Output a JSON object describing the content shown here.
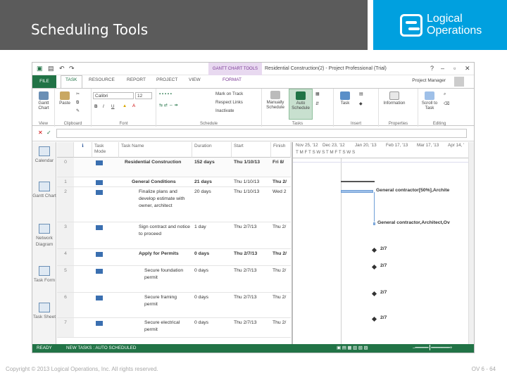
{
  "slide": {
    "title": "Scheduling Tools",
    "logo_line1": "Logical",
    "logo_line2": "Operations",
    "copyright": "Copyright © 2013 Logical Operations, Inc. All rights reserved.",
    "slide_num": "OV 6 - 64"
  },
  "app": {
    "context_tab": "GANTT CHART TOOLS",
    "window_title": "Residential Construction(2) - Project Professional (Trial)",
    "tabs": [
      "FILE",
      "TASK",
      "RESOURCE",
      "REPORT",
      "PROJECT",
      "VIEW",
      "FORMAT"
    ],
    "project_manager": "Project Manager",
    "ribbon": {
      "view": {
        "btn": "Gantt Chart",
        "label": "View"
      },
      "clipboard": {
        "paste": "Paste",
        "label": "Clipboard"
      },
      "font": {
        "name": "Calibri",
        "size": "12",
        "label": "Font"
      },
      "schedule": {
        "mark": "Mark on Track",
        "respect": "Respect Links",
        "inactivate": "Inactivate",
        "label": "Schedule"
      },
      "tasks": {
        "manual": "Manually Schedule",
        "auto": "Auto Schedule",
        "label": "Tasks"
      },
      "insert": {
        "task": "Task",
        "label": "Insert"
      },
      "properties": {
        "info": "Information",
        "label": "Properties"
      },
      "editing": {
        "scroll": "Scroll to Task",
        "label": "Editing"
      }
    },
    "views": [
      "Calendar",
      "Gantt Chart",
      "Network Diagram",
      "Task Form",
      "Task Sheet"
    ],
    "columns": [
      "Task Mode",
      "Task Name",
      "Duration",
      "Start",
      "Finish"
    ],
    "rows": [
      {
        "id": "0",
        "name": "Residential Construction",
        "duration": "152 days",
        "start": "Thu 1/10/13",
        "finish": "Fri 8/",
        "bold": true
      },
      {
        "id": "1",
        "name": "General Conditions",
        "duration": "21 days",
        "start": "Thu 1/10/13",
        "finish": "Thu 2/",
        "bold": true
      },
      {
        "id": "2",
        "name": "Finalize plans and develop estimate with owner, architect",
        "duration": "20 days",
        "start": "Thu 1/10/13",
        "finish": "Wed 2",
        "bold": false
      },
      {
        "id": "3",
        "name": "Sign contract and notice to proceed",
        "duration": "1 day",
        "start": "Thu 2/7/13",
        "finish": "Thu 2/",
        "bold": false
      },
      {
        "id": "4",
        "name": "Apply for Permits",
        "duration": "0 days",
        "start": "Thu 2/7/13",
        "finish": "Thu 2/",
        "bold": true
      },
      {
        "id": "5",
        "name": "Secure foundation permit",
        "duration": "0 days",
        "start": "Thu 2/7/13",
        "finish": "Thu 2/",
        "bold": false
      },
      {
        "id": "6",
        "name": "Secure framing permit",
        "duration": "0 days",
        "start": "Thu 2/7/13",
        "finish": "Thu 2/",
        "bold": false
      },
      {
        "id": "7",
        "name": "Secure electrical permit",
        "duration": "0 days",
        "start": "Thu 2/7/13",
        "finish": "Thu 2/",
        "bold": false
      }
    ],
    "gantt": {
      "months": [
        "Nov 25, '12",
        "Dec 23, '12",
        "Jan 20, '13",
        "Feb 17, '13",
        "Mar 17, '13",
        "Apr 14, '"
      ],
      "days": "T  M  F  T  S  W  S  T  M  F  T  S  W  S",
      "labels": [
        "General contractor[50%],Archite",
        "General contractor,Architect,Ov",
        "2/7",
        "2/7",
        "2/7",
        "2/7"
      ]
    },
    "status": {
      "ready": "READY",
      "new_tasks": "NEW TASKS : AUTO SCHEDULED"
    },
    "colors": {
      "accent": "#217346",
      "context": "#7b3a96",
      "brand": "#00a0df"
    }
  }
}
